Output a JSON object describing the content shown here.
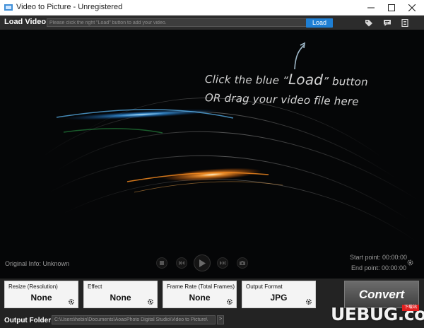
{
  "window": {
    "title": "Video to Picture - Unregistered"
  },
  "load": {
    "label": "Load Video:",
    "placeholder": "Please click the right \"Load\" button to add your video.",
    "button": "Load"
  },
  "preview": {
    "line1_pre": "Click the blue “",
    "line1_load": "Load",
    "line1_post": "” button",
    "line2": "OR drag your video file here"
  },
  "info": {
    "original": "Original Info: Unknown",
    "start": "Start point: 00:00:00",
    "end": "End point: 00:00:00"
  },
  "options": [
    {
      "label": "Resize (Resolution)",
      "value": "None"
    },
    {
      "label": "Effect",
      "value": "None"
    },
    {
      "label": "Frame Rate (Total Frames)",
      "value": "None"
    },
    {
      "label": "Output Format",
      "value": "JPG"
    }
  ],
  "convert": {
    "label": "Convert"
  },
  "output": {
    "label": "Output Folder:",
    "path": "C:\\Users\\hebin\\Documents\\AoaoPhoto Digital Studio\\Video to Picture\\",
    "more": ">"
  },
  "watermark": {
    "text": "UEBUG.com",
    "tag": "下载站"
  },
  "colors": {
    "accent": "#1e7fd4",
    "background": "#050607",
    "panel": "#f4f4f4"
  }
}
